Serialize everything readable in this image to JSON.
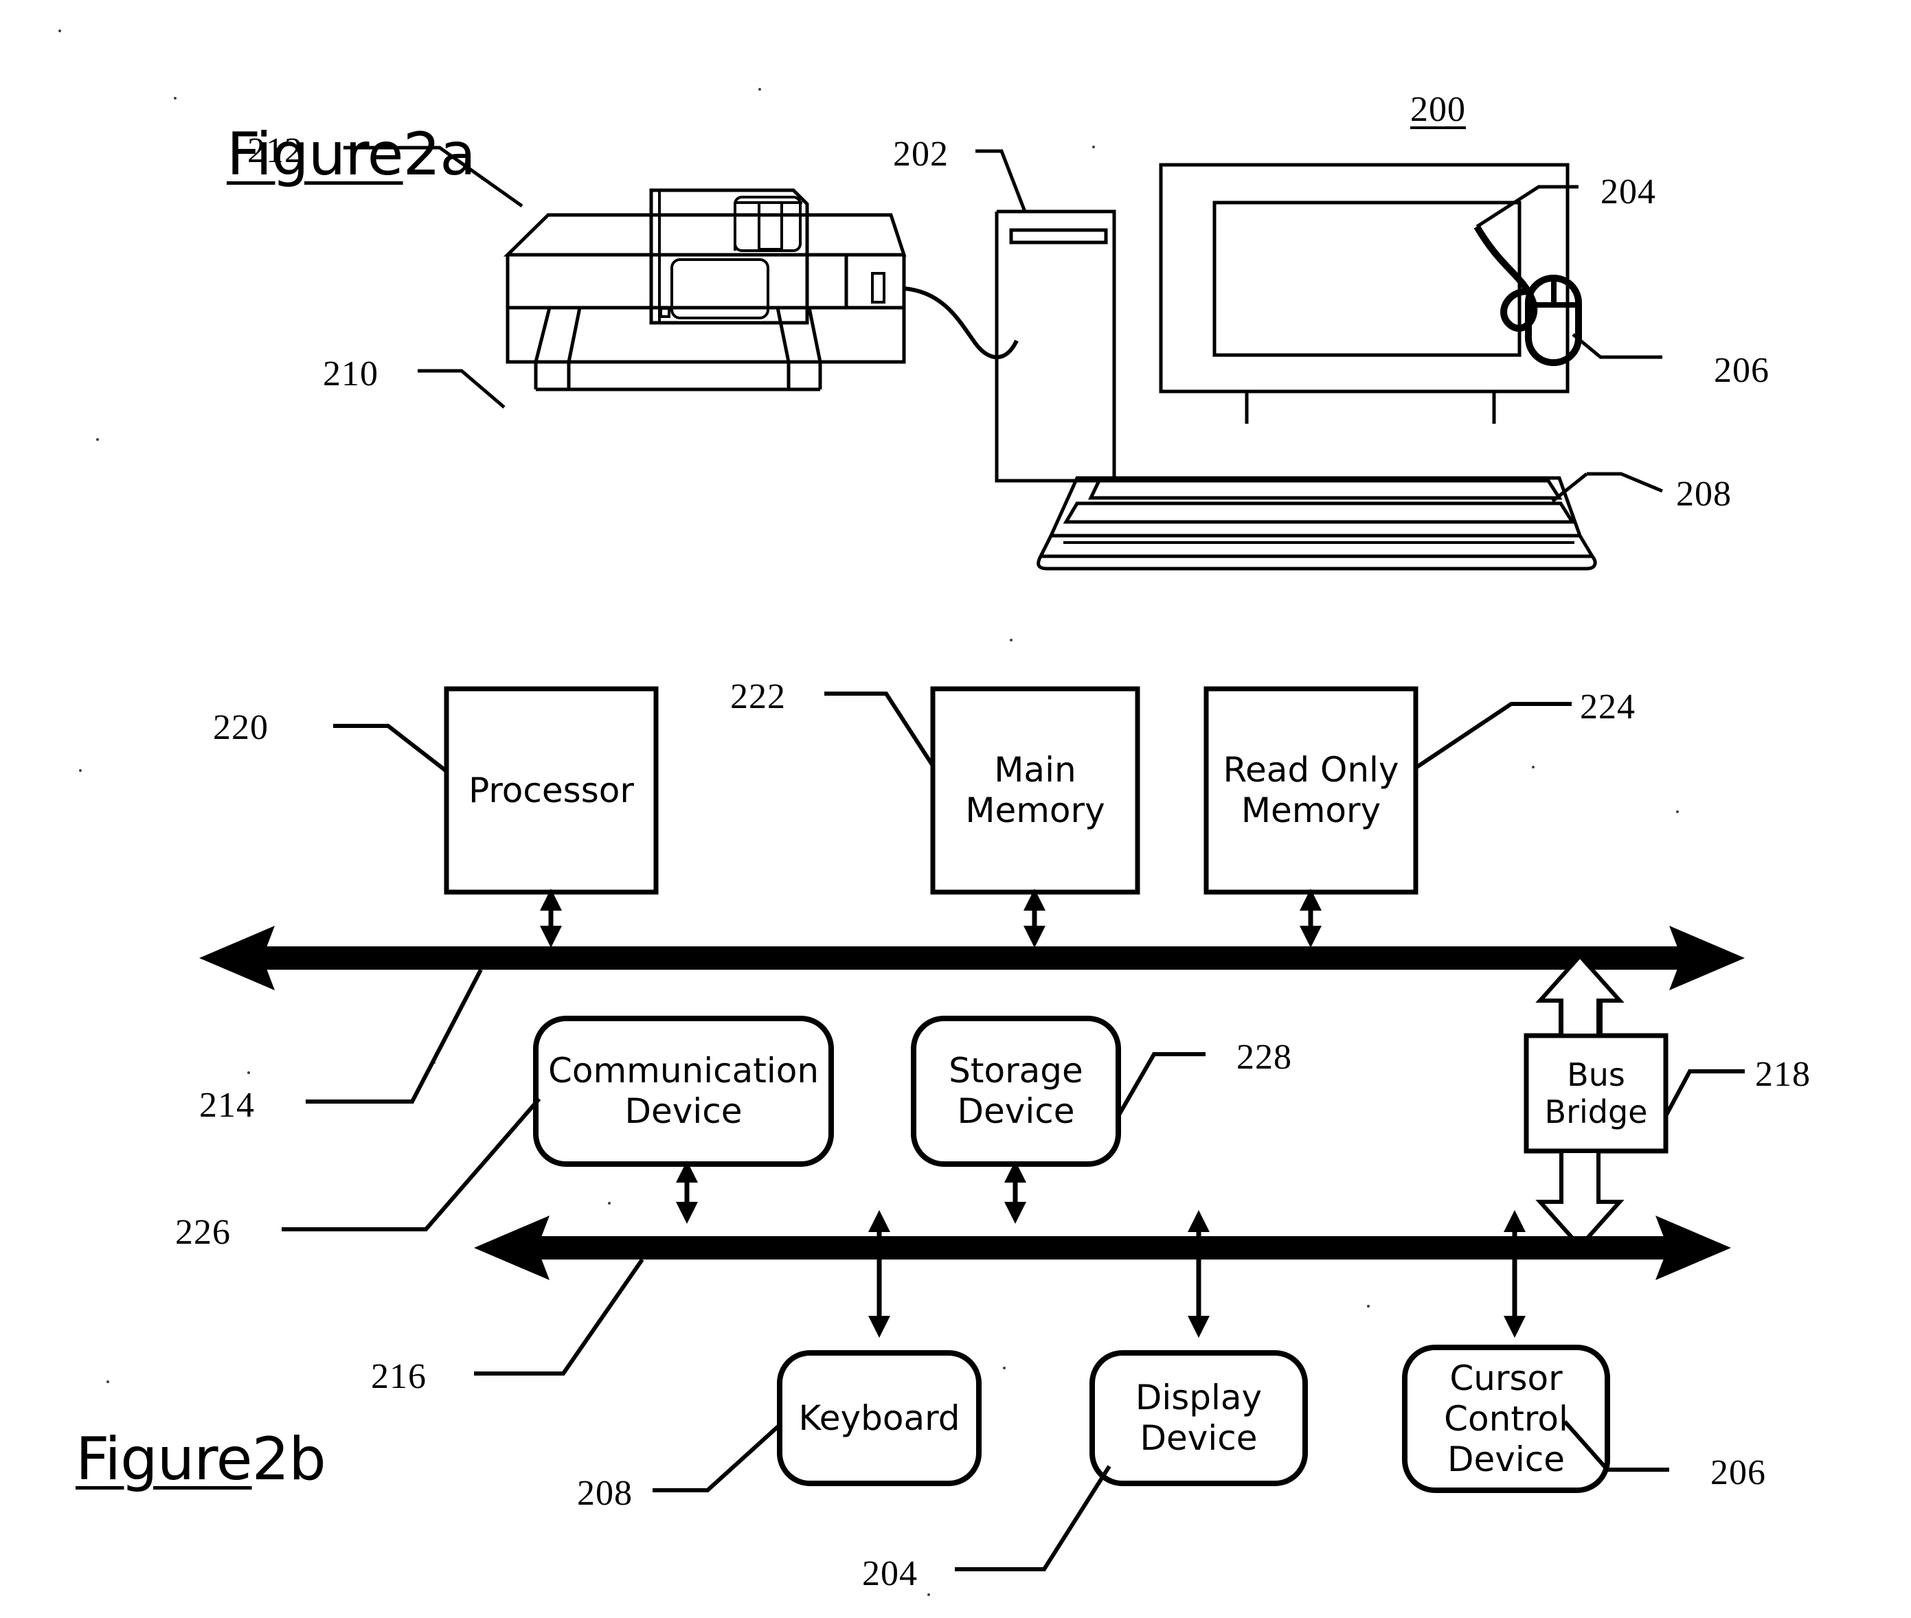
{
  "document": {
    "type": "patent-drawing-sheet",
    "background_color": "#ffffff",
    "ink_color": "#000000"
  },
  "figures": [
    {
      "id": "figure-2a",
      "title_word": "Figure",
      "title_number": "2a",
      "system_ref": "200",
      "components": [
        {
          "ref": "202",
          "name": "computer-tower"
        },
        {
          "ref": "204",
          "name": "display-monitor"
        },
        {
          "ref": "206",
          "name": "mouse"
        },
        {
          "ref": "208",
          "name": "keyboard"
        },
        {
          "ref": "210",
          "name": "printer"
        },
        {
          "ref": "212",
          "name": "floppy-disk"
        }
      ]
    },
    {
      "id": "figure-2b",
      "title_word": "Figure",
      "title_number": "2b",
      "blocks": [
        {
          "ref": "220",
          "label": "Processor",
          "shape": "rect"
        },
        {
          "ref": "222",
          "label": "Main\nMemory",
          "shape": "rect"
        },
        {
          "ref": "224",
          "label": "Read Only\nMemory",
          "shape": "rect"
        },
        {
          "ref": "226",
          "label": "Communication\nDevice",
          "shape": "rounded"
        },
        {
          "ref": "228",
          "label": "Storage\nDevice",
          "shape": "rounded"
        },
        {
          "ref": "218",
          "label": "Bus\nBridge",
          "shape": "rect"
        },
        {
          "ref": "208",
          "label": "Keyboard",
          "shape": "rounded"
        },
        {
          "ref": "204",
          "label": "Display\nDevice",
          "shape": "rounded"
        },
        {
          "ref": "206",
          "label": "Cursor\nControl\nDevice",
          "shape": "rounded"
        }
      ],
      "buses": [
        {
          "ref": "214",
          "name": "primary-bus"
        },
        {
          "ref": "216",
          "name": "secondary-bus"
        }
      ]
    }
  ],
  "labels": {
    "fig2a_title_word": "Figure",
    "fig2a_title_number": "2a",
    "fig2b_title_word": "Figure",
    "fig2b_title_number": "2b",
    "ref_200": "200",
    "ref_202": "202",
    "ref_204_top": "204",
    "ref_206_top": "206",
    "ref_208_top": "208",
    "ref_210": "210",
    "ref_212": "212",
    "ref_214": "214",
    "ref_216": "216",
    "ref_218": "218",
    "ref_220": "220",
    "ref_222": "222",
    "ref_224": "224",
    "ref_226": "226",
    "ref_228": "228",
    "ref_204_bottom": "204",
    "ref_206_bottom": "206",
    "ref_208_bottom": "208",
    "block_processor": "Processor",
    "block_main_memory": "Main\nMemory",
    "block_read_only_memory": "Read Only\nMemory",
    "block_communication_device": "Communication\nDevice",
    "block_storage_device": "Storage\nDevice",
    "block_bus_bridge": "Bus\nBridge",
    "block_keyboard": "Keyboard",
    "block_display_device": "Display\nDevice",
    "block_cursor_control_device": "Cursor\nControl\nDevice"
  }
}
